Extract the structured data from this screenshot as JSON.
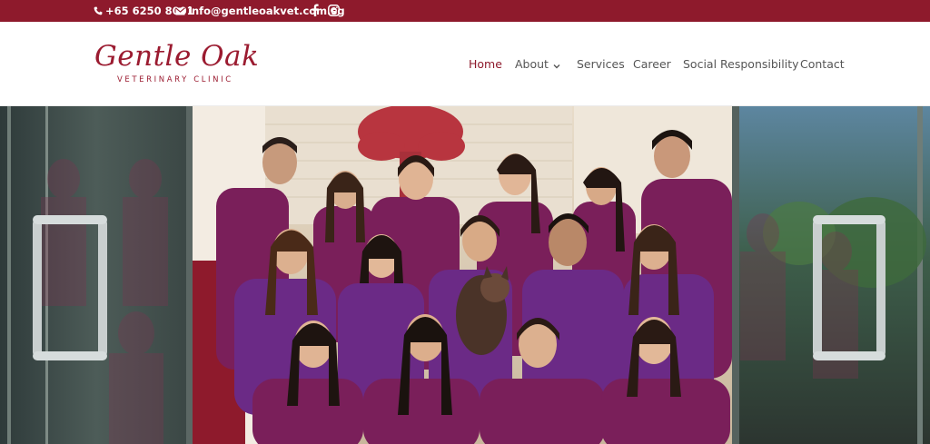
{
  "topbar": {
    "phone": "+65 6250 8001",
    "email": "info@gentleoakvet.com.sg",
    "icons": [
      "phone-icon",
      "envelope-icon",
      "facebook-icon",
      "instagram-icon"
    ],
    "background": "#8e1a2c"
  },
  "logo": {
    "script": "Gentle Oak",
    "subtitle": "VETERINARY CLINIC",
    "color": "#9b1b30"
  },
  "nav": {
    "items": [
      {
        "label": "Home",
        "active": true
      },
      {
        "label": "About",
        "has_dropdown": true
      },
      {
        "label": "Services"
      },
      {
        "label": "Career"
      },
      {
        "label": "Social Responsibility"
      },
      {
        "label": "Contact"
      }
    ],
    "active_color": "#8e1a2c",
    "text_color": "#555555"
  },
  "hero": {
    "scrub_color": "#7a1f5a"
  }
}
